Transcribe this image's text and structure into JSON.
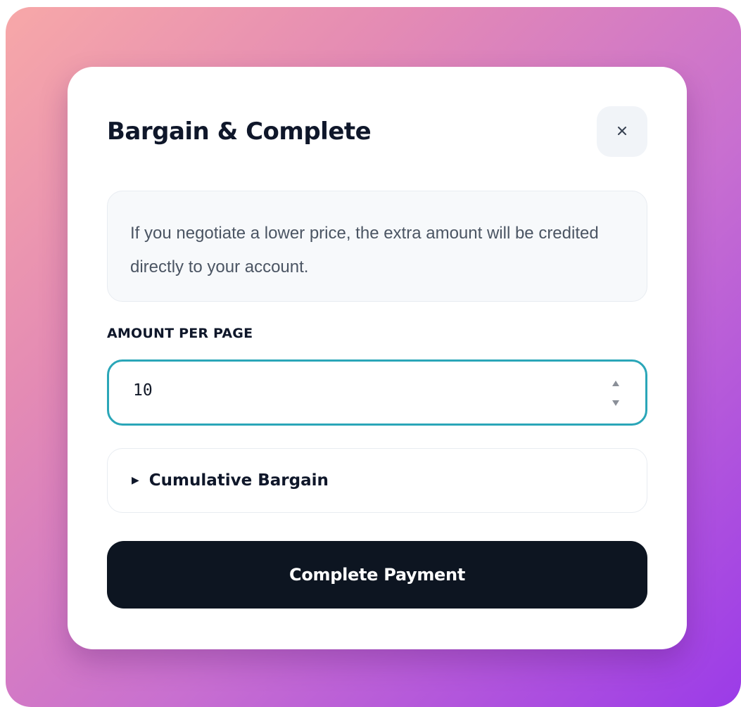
{
  "modal": {
    "title": "Bargain & Complete",
    "close_icon": "close-icon",
    "info_text": "If you negotiate a lower price, the extra amount will be credited directly to your account."
  },
  "amount_field": {
    "label": "AMOUNT PER PAGE",
    "value": "10",
    "spinner_icons": [
      "chevron-up-icon",
      "chevron-down-icon"
    ]
  },
  "cumulative": {
    "caret": "▶",
    "label": "Cumulative Bargain"
  },
  "actions": {
    "complete_label": "Complete Payment"
  },
  "colors": {
    "accent_focus": "#2aa6b8",
    "primary_button": "#0d1521",
    "gradient_start": "#f7a8a8",
    "gradient_end": "#9b3be8"
  }
}
